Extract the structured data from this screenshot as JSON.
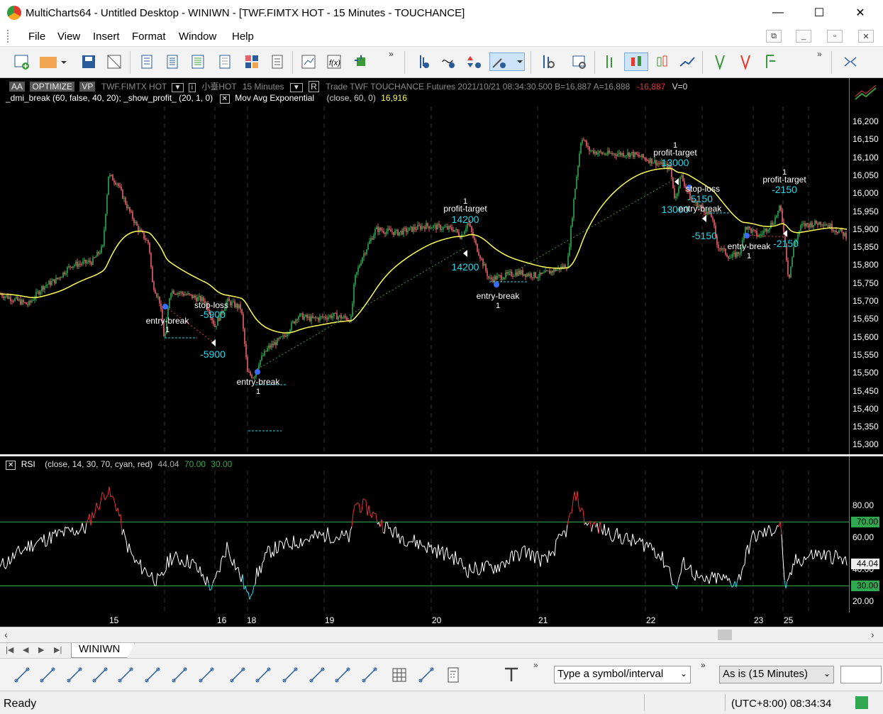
{
  "window": {
    "title": "MultiCharts64 - Untitled Desktop - WINIWN - [TWF.FIMTX HOT - 15 Minutes - TOUCHANCE]",
    "min": "—",
    "max": "☐",
    "close": "✕"
  },
  "menu": [
    "File",
    "View",
    "Insert",
    "Format",
    "Window",
    "Help"
  ],
  "chart_header": {
    "aa": "AA",
    "optimize": "OPTIMIZE",
    "vp": "VP",
    "symbol": "TWF.FIMTX HOT",
    "symbol2": "小臺HOT",
    "interval": "15 Minutes",
    "r": "R",
    "info": "Trade   TWF   TOUCHANCE   Futures   2021/10/21   08:34:30.500   B=16,887   A=16,888",
    "change": "-16,887",
    "volume": "V=0",
    "strategy": "_dmi_break (60,  false,  40,  20); _show_profit_ (20,  1,  0)",
    "ma_label": "Mov Avg Exponential",
    "ma_params": "(close,  60,  0)",
    "ma_value": "16,916"
  },
  "price_axis": {
    "ticks": [
      "16,200",
      "16,150",
      "16,100",
      "16,050",
      "16,000",
      "15,950",
      "15,900",
      "15,850",
      "15,800",
      "15,750",
      "15,700",
      "15,650",
      "15,600",
      "15,550",
      "15,500",
      "15,450",
      "15,400",
      "15,350",
      "15,300"
    ]
  },
  "annotations": [
    {
      "t": "entry-break",
      "c": "#fff"
    },
    {
      "t": "1",
      "c": "#fff"
    },
    {
      "t": "stop-loss",
      "c": "#fff"
    },
    {
      "t": "-5900",
      "c": "#26d7e8"
    },
    {
      "t": "-5900",
      "c": "#26d7e8"
    },
    {
      "t": "entry-break",
      "c": "#fff"
    },
    {
      "t": "1",
      "c": "#fff"
    },
    {
      "t": "1",
      "c": "#fff"
    },
    {
      "t": "profit-target",
      "c": "#fff"
    },
    {
      "t": "14200",
      "c": "#26d7e8"
    },
    {
      "t": "14200",
      "c": "#26d7e8"
    },
    {
      "t": "entry-break",
      "c": "#fff"
    },
    {
      "t": "1",
      "c": "#fff"
    },
    {
      "t": "1",
      "c": "#fff"
    },
    {
      "t": "profit-target",
      "c": "#fff"
    },
    {
      "t": "13000",
      "c": "#26d7e8"
    },
    {
      "t": "13000",
      "c": "#26d7e8"
    },
    {
      "t": "stop-loss",
      "c": "#fff"
    },
    {
      "t": "-5150",
      "c": "#26d7e8"
    },
    {
      "t": "entry-break",
      "c": "#fff"
    },
    {
      "t": "-5150",
      "c": "#26d7e8"
    },
    {
      "t": "entry-break",
      "c": "#fff"
    },
    {
      "t": "1",
      "c": "#fff"
    },
    {
      "t": "1",
      "c": "#fff"
    },
    {
      "t": "profit-target",
      "c": "#fff"
    },
    {
      "t": "-2150",
      "c": "#26d7e8"
    },
    {
      "t": "-2150",
      "c": "#26d7e8"
    }
  ],
  "rsi_header": {
    "name": "RSI",
    "params": "(close,  14,  30,  70,  cyan,  red)",
    "value": "44.04",
    "ob": "70.00",
    "os": "30.00"
  },
  "rsi_axis": {
    "ticks": [
      "80.00",
      "60.00",
      "40.00",
      "20.00"
    ],
    "ob_badge": "70.00",
    "os_badge": "30.00",
    "val_badge": "44.04"
  },
  "time_axis": [
    "15",
    "16",
    "18",
    "19",
    "20",
    "21",
    "22",
    "23",
    "25"
  ],
  "tab": "WINIWN",
  "drawbar": {
    "symbol_placeholder": "Type a symbol/interval",
    "interval": "As is (15 Minutes)"
  },
  "status": {
    "ready": "Ready",
    "clock": "(UTC+8:00) 08:34:34"
  },
  "colors": {
    "ma": "#ffff55",
    "up": "#2fa84f",
    "down": "#e8606a",
    "cyan": "#26d7e8",
    "rsi_ob": "#2fa84f",
    "rsi_line": "#ffffff",
    "rsi_hot": "#e8303a"
  }
}
